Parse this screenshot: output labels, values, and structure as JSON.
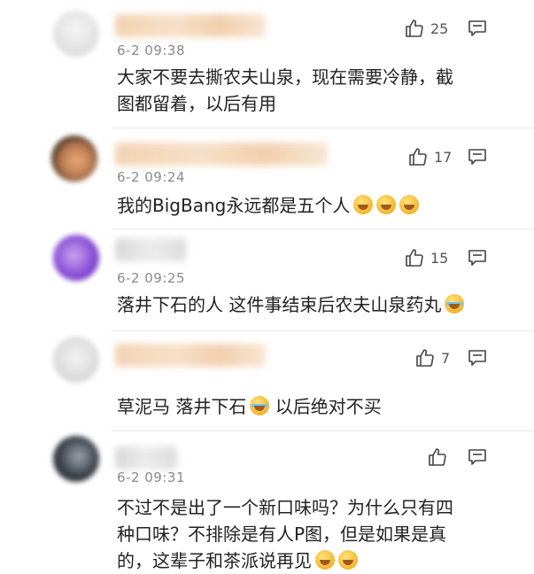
{
  "comments": [
    {
      "time": "6-2 09:38",
      "likes": "25",
      "text_lines": [
        "大家不要去撕农夫山泉，现在需要冷静，截",
        "图都留着，以后有用"
      ]
    },
    {
      "time": "6-2 09:24",
      "likes": "17",
      "text": "我的BigBang永远都是五个人"
    },
    {
      "time": "6-2 09:25",
      "likes": "15",
      "text": "落井下石的人 这件事结束后农夫山泉药丸"
    },
    {
      "time": "",
      "likes": "7",
      "text_a": "草泥马 落井下石",
      "text_b": " 以后绝对不买"
    },
    {
      "time": "6-2 09:31",
      "likes": "",
      "text_lines": [
        "不过不是出了一个新口味吗？为什么只有四",
        "种口味？不排除是有人P图，但是如果是真",
        "的，这辈子和茶派说再见"
      ]
    }
  ],
  "icons": {
    "like": "thumbs-up-icon",
    "more": "comment-more-icon",
    "emoji": "emoji-icon"
  },
  "colors": {
    "name_blur": "#f3d2b3",
    "time": "#8a8a8a",
    "divider": "#e9e9e9"
  }
}
